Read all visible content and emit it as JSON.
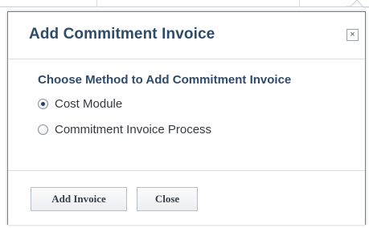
{
  "dialog": {
    "title": "Add Commitment Invoice",
    "close_glyph": "×",
    "close_icon": "close-icon",
    "section_label": "Choose Method to Add Commitment Invoice",
    "options": [
      {
        "label": "Cost Module",
        "selected": true
      },
      {
        "label": "Commitment Invoice Process",
        "selected": false
      }
    ],
    "buttons": {
      "add_label": "Add Invoice",
      "close_label": "Close"
    }
  },
  "colors": {
    "title": "#2e4b6b",
    "border": "#7a7f86",
    "text": "#333a42"
  }
}
